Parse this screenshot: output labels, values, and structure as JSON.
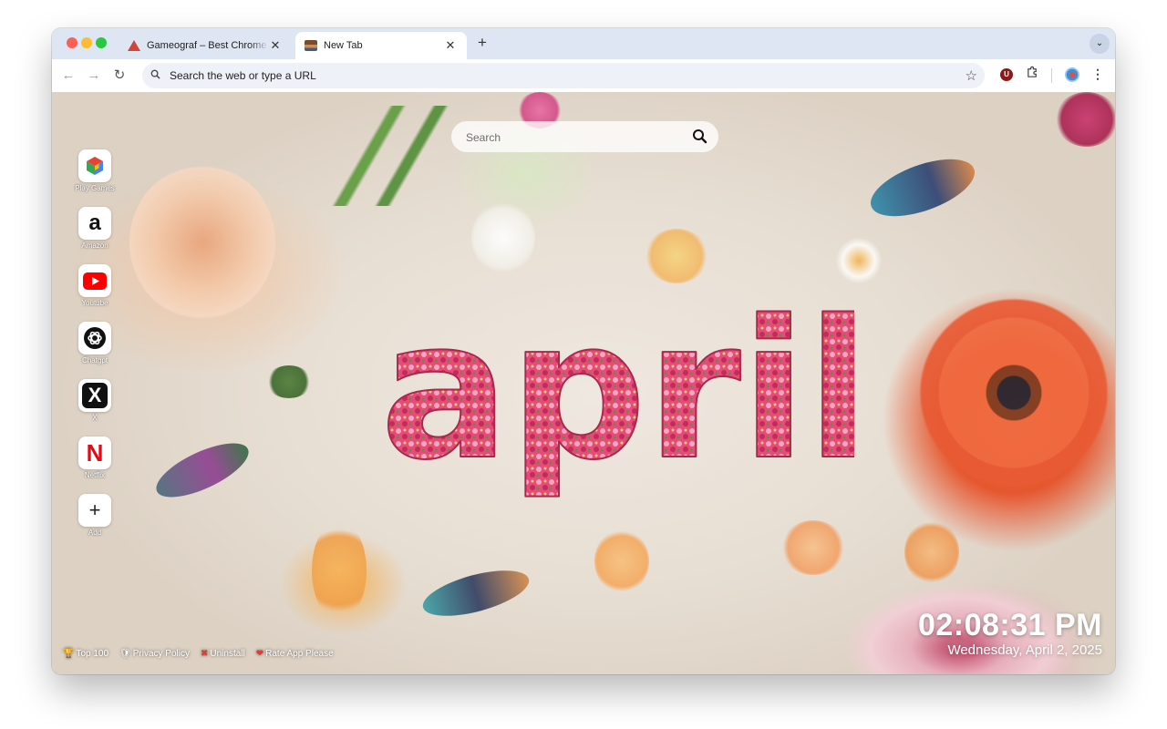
{
  "tabs": [
    {
      "title": "Gameograf – Best Chrome Li",
      "favicon": "gameograf-triangle-icon",
      "active": false
    },
    {
      "title": "New Tab",
      "favicon": "april-wallpaper-thumbnail-icon",
      "active": true
    }
  ],
  "toolbar": {
    "omnibox_placeholder": "Search the web or type a URL",
    "icons": [
      "back-arrow-icon",
      "forward-arrow-icon",
      "reload-icon",
      "search-icon",
      "star-icon",
      "ublock-u-icon",
      "extensions-puzzle-icon",
      "profile-avatar-icon",
      "more-menu-icon"
    ],
    "ext_u_letter": "U"
  },
  "newtab": {
    "search_placeholder": "Search",
    "wallpaper_word": "april",
    "shortcuts": [
      {
        "label": "Play Games",
        "icon": "play-games-cube-icon"
      },
      {
        "label": "Amazon",
        "icon": "amazon-a-icon",
        "glyph": "a"
      },
      {
        "label": "Youtube",
        "icon": "youtube-play-icon"
      },
      {
        "label": "Chatgpt",
        "icon": "chatgpt-knot-icon"
      },
      {
        "label": "X",
        "icon": "x-logo-icon",
        "glyph": "X"
      },
      {
        "label": "Netflix",
        "icon": "netflix-n-icon",
        "glyph": "N"
      },
      {
        "label": "Add",
        "icon": "plus-icon",
        "glyph": "+"
      }
    ],
    "footer_links": [
      {
        "icon": "trophy-icon",
        "glyph": "🏆",
        "label": "Top 100"
      },
      {
        "icon": "shield-icon",
        "glyph": "🛡",
        "label": "Privacy Policy"
      },
      {
        "icon": "cross-mark-icon",
        "glyph": "✖",
        "label": "Uninstall"
      },
      {
        "icon": "heart-icon",
        "glyph": "❤",
        "label": "Rate App Please"
      }
    ],
    "clock": {
      "time": "02:08:31 PM",
      "date": "Wednesday, April 2, 2025"
    }
  },
  "colors": {
    "tab_strip": "#dee5f3",
    "accent_red": "#d0463a",
    "youtube_red": "#ff0000",
    "netflix_red": "#e50914"
  }
}
